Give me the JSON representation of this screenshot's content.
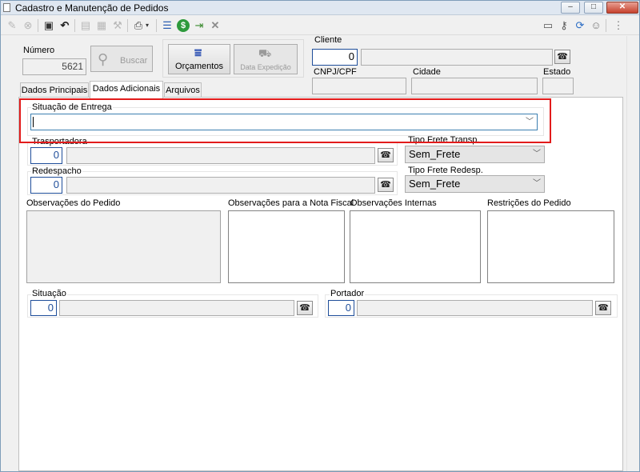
{
  "window": {
    "title": "Cadastro e Manutenção de Pedidos",
    "minimize_icon": "minimize-icon",
    "maximize_icon": "maximize-icon",
    "close_icon": "close-icon"
  },
  "header": {
    "numero_label": "Número",
    "numero_value": "5621",
    "buscar_label": "Buscar",
    "orcamentos_label": "Orçamentos",
    "data_expedicao_label": "Data Expedição",
    "cliente_label": "Cliente",
    "cliente_code": "0",
    "cnpj_label": "CNPJ/CPF",
    "cidade_label": "Cidade",
    "estado_label": "Estado"
  },
  "tabs": [
    {
      "label": "Dados Principais",
      "active": false
    },
    {
      "label": "Dados Adicionais",
      "active": true
    },
    {
      "label": "Arquivos",
      "active": false
    }
  ],
  "form": {
    "situacao_entrega_label": "Situação de Entrega",
    "situacao_entrega_value": "",
    "transportadora_label": "Trasportadora",
    "transportadora_code": "0",
    "tipo_frete_transp_label": "Tipo Frete Transp.",
    "tipo_frete_transp_value": "Sem_Frete",
    "redespacho_label": "Redespacho",
    "redespacho_code": "0",
    "tipo_frete_redesp_label": "Tipo Frete Redesp.",
    "tipo_frete_redesp_value": "Sem_Frete",
    "obs_pedido_label": "Observações do Pedido",
    "obs_nota_label": "Observações para a Nota Fiscal",
    "obs_internas_label": "Observações Internas",
    "restricoes_label": "Restrições do Pedido",
    "situacao_label": "Situação",
    "situacao_code": "0",
    "portador_label": "Portador",
    "portador_code": "0"
  },
  "colors": {
    "highlight": "#e21b1b",
    "field_focus_border": "#3c7fb1",
    "combo_bg": "#e5e5e5"
  }
}
